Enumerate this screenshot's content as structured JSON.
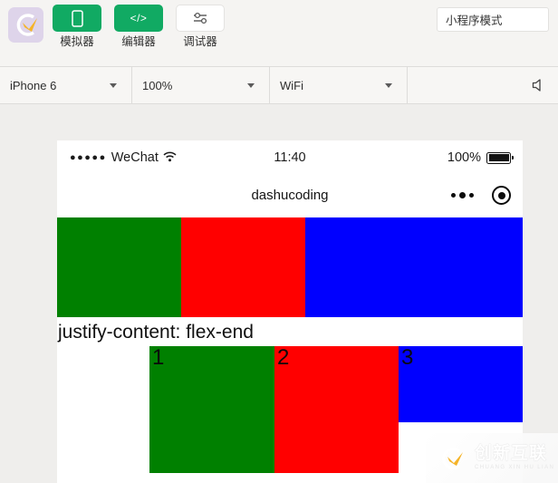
{
  "toolbar": {
    "logo_icon": "wechat-devtools-logo",
    "buttons": [
      {
        "icon": "phone-simulator-icon",
        "label": "模拟器",
        "active": true
      },
      {
        "icon": "code-editor-icon",
        "label": "编辑器",
        "active": true
      },
      {
        "icon": "debugger-sliders-icon",
        "label": "调试器",
        "active": false
      }
    ],
    "mode_select": {
      "label": "小程序模式",
      "icon": "dropdown"
    }
  },
  "selectbar": {
    "device": "iPhone 6",
    "zoom": "100%",
    "network": "WiFi",
    "mute_icon": "speaker-mute-icon"
  },
  "phone": {
    "statusbar": {
      "signal_dots": "●●●●●",
      "carrier": "WeChat",
      "wifi_icon": "wifi-icon",
      "time": "11:40",
      "battery_percent": "100%",
      "battery_icon": "battery-full-icon"
    },
    "navbar": {
      "title": "dashucoding",
      "menu_icon": "more-dots-icon",
      "close_icon": "target-circle-icon"
    },
    "row1": {
      "boxes": [
        {
          "label": "",
          "color": "#008000",
          "name": "green"
        },
        {
          "label": "",
          "color": "#ff0000",
          "name": "red"
        },
        {
          "label": "",
          "color": "#0000ff",
          "name": "blue"
        }
      ]
    },
    "caption": "justify-content: flex-end",
    "row2": {
      "boxes": [
        {
          "label": "1",
          "color": "#008000",
          "name": "green"
        },
        {
          "label": "2",
          "color": "#ff0000",
          "name": "red"
        },
        {
          "label": "3",
          "color": "#0000ff",
          "name": "blue"
        }
      ]
    }
  },
  "watermark": {
    "logo_icon": "chuangxin-hulian-logo",
    "title": "创新互联",
    "subtitle": "CHUANG XIN HU LIAN"
  }
}
